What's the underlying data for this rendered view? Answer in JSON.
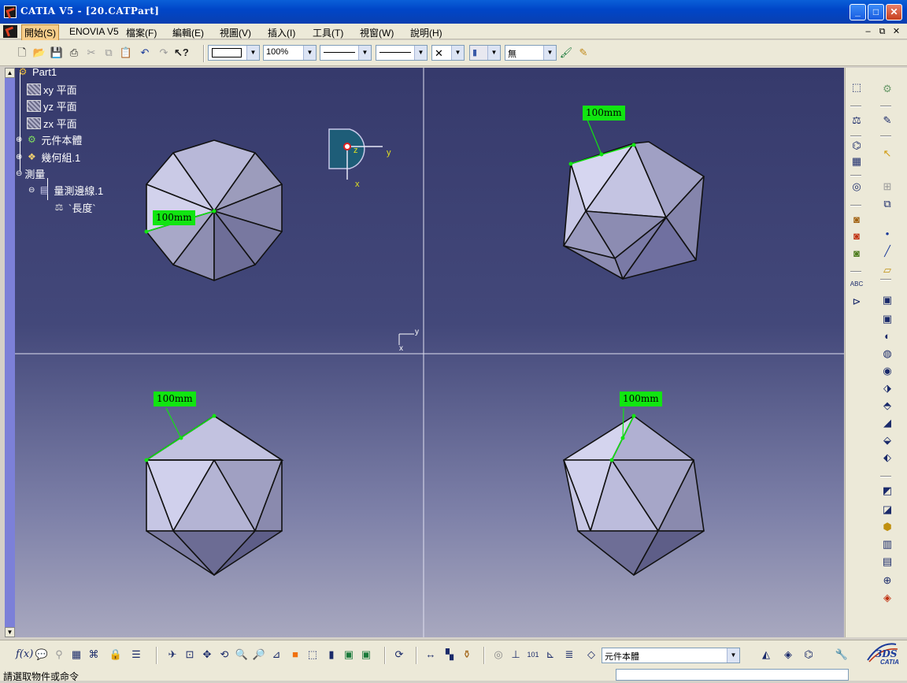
{
  "window": {
    "title": "CATIA V5 - [20.CATPart]",
    "min": "_",
    "max": "□",
    "close": "✕"
  },
  "menubar": {
    "items": [
      "開始(S)",
      "ENOVIA V5",
      "檔案(F)",
      "編輯(E)",
      "視圖(V)",
      "插入(I)",
      "工具(T)",
      "視窗(W)",
      "說明(H)"
    ],
    "mdi": [
      "–",
      "⧉",
      "✕"
    ]
  },
  "toolbar": {
    "line_style_value": "",
    "zoom_value": "100%",
    "layer_value": "無"
  },
  "tree": {
    "root": "Part1",
    "items": [
      "xy 平面",
      "yz 平面",
      "zx 平面",
      "元件本體",
      "幾何組.1",
      "測量",
      "量測邊線.1",
      "`長度`"
    ]
  },
  "compass": {
    "x_label": "x",
    "y_label": "y",
    "z_label": "z"
  },
  "axis_small": {
    "x_label": "x",
    "y_label": "y"
  },
  "measurements": [
    "100mm",
    "100mm",
    "100mm",
    "100mm"
  ],
  "bottom_toolbar": {
    "current_body": "元件本體"
  },
  "status": {
    "message": "請選取物件或命令"
  },
  "colors": {
    "measure_label": "#11e511",
    "viewport_top": "#363a6c",
    "viewport_bottom": "#a8a8bf",
    "solid_light": "#d0d0ea",
    "solid_dark": "#64648a"
  }
}
